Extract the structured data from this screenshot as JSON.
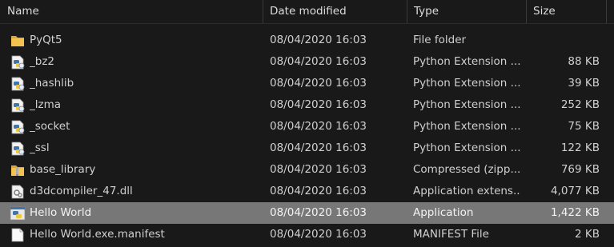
{
  "columns": {
    "name": "Name",
    "date": "Date modified",
    "type": "Type",
    "size": "Size"
  },
  "sort_indicator": "^",
  "files": [
    {
      "icon": "folder-icon",
      "name": "PyQt5",
      "date": "08/04/2020 16:03",
      "type": "File folder",
      "size": ""
    },
    {
      "icon": "python-extension-icon",
      "name": "_bz2",
      "date": "08/04/2020 16:03",
      "type": "Python Extension ...",
      "size": "88 KB"
    },
    {
      "icon": "python-extension-icon",
      "name": "_hashlib",
      "date": "08/04/2020 16:03",
      "type": "Python Extension ...",
      "size": "39 KB"
    },
    {
      "icon": "python-extension-icon",
      "name": "_lzma",
      "date": "08/04/2020 16:03",
      "type": "Python Extension ...",
      "size": "252 KB"
    },
    {
      "icon": "python-extension-icon",
      "name": "_socket",
      "date": "08/04/2020 16:03",
      "type": "Python Extension ...",
      "size": "75 KB"
    },
    {
      "icon": "python-extension-icon",
      "name": "_ssl",
      "date": "08/04/2020 16:03",
      "type": "Python Extension ...",
      "size": "122 KB"
    },
    {
      "icon": "zip-folder-icon",
      "name": "base_library",
      "date": "08/04/2020 16:03",
      "type": "Compressed (zipp...",
      "size": "769 KB"
    },
    {
      "icon": "dll-file-icon",
      "name": "d3dcompiler_47.dll",
      "date": "08/04/2020 16:03",
      "type": "Application extens...",
      "size": "4,077 KB"
    },
    {
      "icon": "python-app-icon",
      "name": "Hello World",
      "date": "08/04/2020 16:03",
      "type": "Application",
      "size": "1,422 KB",
      "selected": true
    },
    {
      "icon": "blank-file-icon",
      "name": "Hello World.exe.manifest",
      "date": "08/04/2020 16:03",
      "type": "MANIFEST File",
      "size": "2 KB"
    }
  ],
  "colors": {
    "background": "#191919",
    "selected_row": "#777777",
    "text": "#d0d0d0",
    "folder": "#e8b53a"
  }
}
